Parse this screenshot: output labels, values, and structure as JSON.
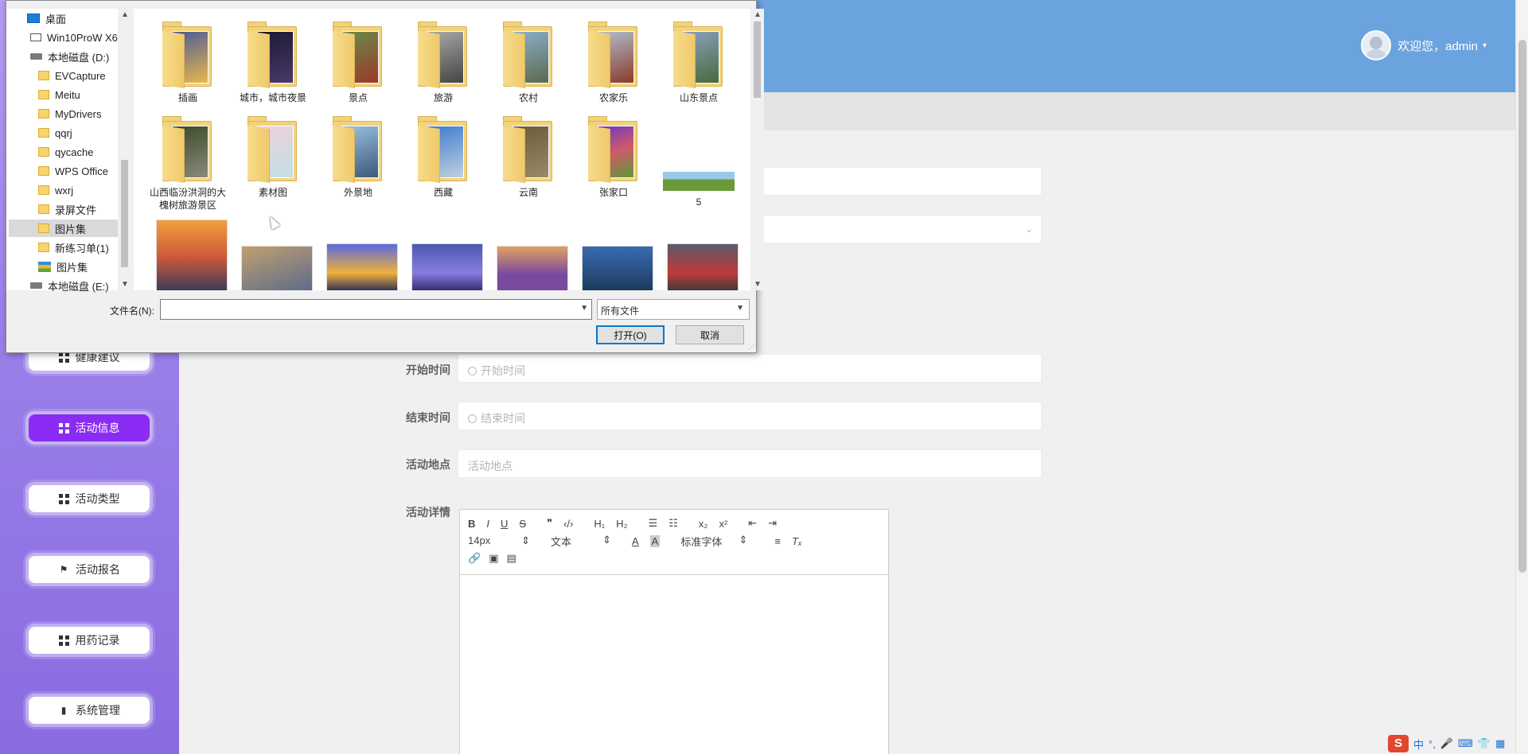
{
  "header": {
    "welcome": "欢迎您，admin",
    "caret": "▾"
  },
  "sidebar": {
    "items": [
      {
        "label": "健康建议",
        "icon": "grid-icon",
        "active": false
      },
      {
        "label": "活动信息",
        "icon": "grid-icon",
        "active": true
      },
      {
        "label": "活动类型",
        "icon": "grid-icon",
        "active": false
      },
      {
        "label": "活动报名",
        "icon": "flag-icon",
        "active": false
      },
      {
        "label": "用药记录",
        "icon": "grid-icon",
        "active": false
      },
      {
        "label": "系统管理",
        "icon": "bar-chart-icon",
        "active": false
      }
    ]
  },
  "form": {
    "start_label": "开始时间",
    "start_placeholder": "开始时间",
    "end_label": "结束时间",
    "end_placeholder": "结束时间",
    "location_label": "活动地点",
    "location_placeholder": "活动地点",
    "details_label": "活动详情"
  },
  "editor": {
    "font_size": "14px",
    "paragraph": "文本",
    "font_family": "标准字体"
  },
  "dialog": {
    "nav_items": [
      {
        "label": "桌面",
        "icon": "desktop-icon"
      },
      {
        "label": "Win10ProW X6",
        "icon": "pc-icon"
      },
      {
        "label": "本地磁盘 (D:)",
        "icon": "drive-icon"
      },
      {
        "label": "EVCapture",
        "icon": "folder-icon"
      },
      {
        "label": "Meitu",
        "icon": "folder-icon"
      },
      {
        "label": "MyDrivers",
        "icon": "folder-icon"
      },
      {
        "label": "qqrj",
        "icon": "folder-icon"
      },
      {
        "label": "qycache",
        "icon": "folder-icon"
      },
      {
        "label": "WPS Office",
        "icon": "folder-icon"
      },
      {
        "label": "wxrj",
        "icon": "folder-icon"
      },
      {
        "label": "录屏文件",
        "icon": "folder-icon"
      },
      {
        "label": "图片集",
        "icon": "folder-icon",
        "selected": true
      },
      {
        "label": "新练习单(1)",
        "icon": "folder-icon"
      },
      {
        "label": "图片集",
        "icon": "library-icon"
      },
      {
        "label": "本地磁盘 (E:)",
        "icon": "drive-icon"
      }
    ],
    "folders_row1": [
      "插画",
      "城市，城市夜景",
      "景点",
      "旅游",
      "农村",
      "农家乐",
      "山东景点"
    ],
    "folders_row2": [
      "山西临汾洪洞的大槐树旅游景区",
      "素材图",
      "外景地",
      "西藏",
      "云南",
      "张家口"
    ],
    "image_item": "5",
    "filename_label": "文件名(N):",
    "filename_value": "",
    "filetype": "所有文件",
    "open_button": "打开(O)",
    "cancel_button": "取消"
  },
  "ime": {
    "logo": "S",
    "mode": "中"
  }
}
